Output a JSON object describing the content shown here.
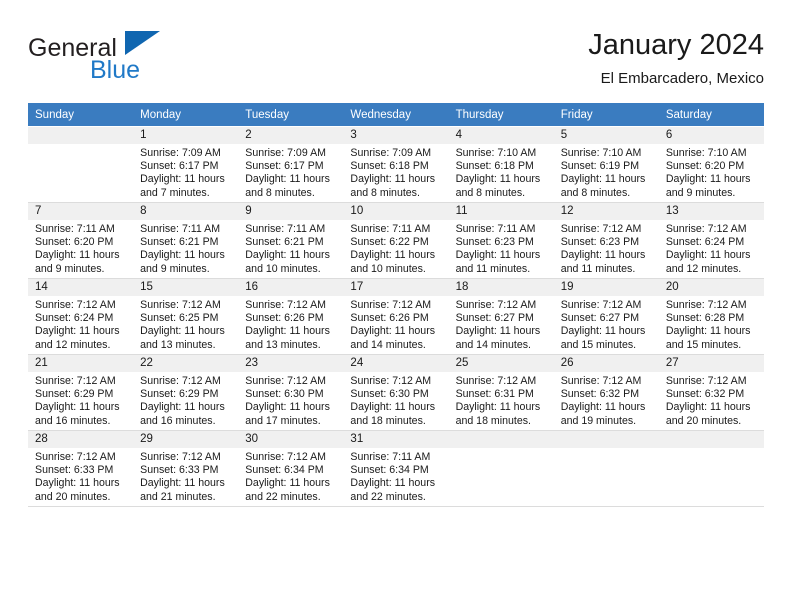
{
  "brand": {
    "name_part1": "General",
    "name_part2": "Blue",
    "triangle_icon": "triangle-logo-icon",
    "accent_color": "#1066b0",
    "text_color": "#2079c7"
  },
  "header": {
    "title": "January 2024",
    "subtitle": "El Embarcadero, Mexico"
  },
  "calendar": {
    "header_bg": "#3a7cc0",
    "header_text_color": "#ffffff",
    "daynum_bg": "#f0f0f0",
    "weekday_headers": [
      "Sunday",
      "Monday",
      "Tuesday",
      "Wednesday",
      "Thursday",
      "Friday",
      "Saturday"
    ],
    "labels": {
      "sunrise": "Sunrise:",
      "sunset": "Sunset:",
      "daylight": "Daylight:"
    },
    "weeks": [
      [
        {
          "day": "",
          "empty": true,
          "sunrise": "",
          "sunset": "",
          "daylight_line1": "",
          "daylight_line2": ""
        },
        {
          "day": "1",
          "sunrise": "Sunrise: 7:09 AM",
          "sunset": "Sunset: 6:17 PM",
          "daylight_line1": "Daylight: 11 hours",
          "daylight_line2": "and 7 minutes."
        },
        {
          "day": "2",
          "sunrise": "Sunrise: 7:09 AM",
          "sunset": "Sunset: 6:17 PM",
          "daylight_line1": "Daylight: 11 hours",
          "daylight_line2": "and 8 minutes."
        },
        {
          "day": "3",
          "sunrise": "Sunrise: 7:09 AM",
          "sunset": "Sunset: 6:18 PM",
          "daylight_line1": "Daylight: 11 hours",
          "daylight_line2": "and 8 minutes."
        },
        {
          "day": "4",
          "sunrise": "Sunrise: 7:10 AM",
          "sunset": "Sunset: 6:18 PM",
          "daylight_line1": "Daylight: 11 hours",
          "daylight_line2": "and 8 minutes."
        },
        {
          "day": "5",
          "sunrise": "Sunrise: 7:10 AM",
          "sunset": "Sunset: 6:19 PM",
          "daylight_line1": "Daylight: 11 hours",
          "daylight_line2": "and 8 minutes."
        },
        {
          "day": "6",
          "sunrise": "Sunrise: 7:10 AM",
          "sunset": "Sunset: 6:20 PM",
          "daylight_line1": "Daylight: 11 hours",
          "daylight_line2": "and 9 minutes."
        }
      ],
      [
        {
          "day": "7",
          "sunrise": "Sunrise: 7:11 AM",
          "sunset": "Sunset: 6:20 PM",
          "daylight_line1": "Daylight: 11 hours",
          "daylight_line2": "and 9 minutes."
        },
        {
          "day": "8",
          "sunrise": "Sunrise: 7:11 AM",
          "sunset": "Sunset: 6:21 PM",
          "daylight_line1": "Daylight: 11 hours",
          "daylight_line2": "and 9 minutes."
        },
        {
          "day": "9",
          "sunrise": "Sunrise: 7:11 AM",
          "sunset": "Sunset: 6:21 PM",
          "daylight_line1": "Daylight: 11 hours",
          "daylight_line2": "and 10 minutes."
        },
        {
          "day": "10",
          "sunrise": "Sunrise: 7:11 AM",
          "sunset": "Sunset: 6:22 PM",
          "daylight_line1": "Daylight: 11 hours",
          "daylight_line2": "and 10 minutes."
        },
        {
          "day": "11",
          "sunrise": "Sunrise: 7:11 AM",
          "sunset": "Sunset: 6:23 PM",
          "daylight_line1": "Daylight: 11 hours",
          "daylight_line2": "and 11 minutes."
        },
        {
          "day": "12",
          "sunrise": "Sunrise: 7:12 AM",
          "sunset": "Sunset: 6:23 PM",
          "daylight_line1": "Daylight: 11 hours",
          "daylight_line2": "and 11 minutes."
        },
        {
          "day": "13",
          "sunrise": "Sunrise: 7:12 AM",
          "sunset": "Sunset: 6:24 PM",
          "daylight_line1": "Daylight: 11 hours",
          "daylight_line2": "and 12 minutes."
        }
      ],
      [
        {
          "day": "14",
          "sunrise": "Sunrise: 7:12 AM",
          "sunset": "Sunset: 6:24 PM",
          "daylight_line1": "Daylight: 11 hours",
          "daylight_line2": "and 12 minutes."
        },
        {
          "day": "15",
          "sunrise": "Sunrise: 7:12 AM",
          "sunset": "Sunset: 6:25 PM",
          "daylight_line1": "Daylight: 11 hours",
          "daylight_line2": "and 13 minutes."
        },
        {
          "day": "16",
          "sunrise": "Sunrise: 7:12 AM",
          "sunset": "Sunset: 6:26 PM",
          "daylight_line1": "Daylight: 11 hours",
          "daylight_line2": "and 13 minutes."
        },
        {
          "day": "17",
          "sunrise": "Sunrise: 7:12 AM",
          "sunset": "Sunset: 6:26 PM",
          "daylight_line1": "Daylight: 11 hours",
          "daylight_line2": "and 14 minutes."
        },
        {
          "day": "18",
          "sunrise": "Sunrise: 7:12 AM",
          "sunset": "Sunset: 6:27 PM",
          "daylight_line1": "Daylight: 11 hours",
          "daylight_line2": "and 14 minutes."
        },
        {
          "day": "19",
          "sunrise": "Sunrise: 7:12 AM",
          "sunset": "Sunset: 6:27 PM",
          "daylight_line1": "Daylight: 11 hours",
          "daylight_line2": "and 15 minutes."
        },
        {
          "day": "20",
          "sunrise": "Sunrise: 7:12 AM",
          "sunset": "Sunset: 6:28 PM",
          "daylight_line1": "Daylight: 11 hours",
          "daylight_line2": "and 15 minutes."
        }
      ],
      [
        {
          "day": "21",
          "sunrise": "Sunrise: 7:12 AM",
          "sunset": "Sunset: 6:29 PM",
          "daylight_line1": "Daylight: 11 hours",
          "daylight_line2": "and 16 minutes."
        },
        {
          "day": "22",
          "sunrise": "Sunrise: 7:12 AM",
          "sunset": "Sunset: 6:29 PM",
          "daylight_line1": "Daylight: 11 hours",
          "daylight_line2": "and 16 minutes."
        },
        {
          "day": "23",
          "sunrise": "Sunrise: 7:12 AM",
          "sunset": "Sunset: 6:30 PM",
          "daylight_line1": "Daylight: 11 hours",
          "daylight_line2": "and 17 minutes."
        },
        {
          "day": "24",
          "sunrise": "Sunrise: 7:12 AM",
          "sunset": "Sunset: 6:30 PM",
          "daylight_line1": "Daylight: 11 hours",
          "daylight_line2": "and 18 minutes."
        },
        {
          "day": "25",
          "sunrise": "Sunrise: 7:12 AM",
          "sunset": "Sunset: 6:31 PM",
          "daylight_line1": "Daylight: 11 hours",
          "daylight_line2": "and 18 minutes."
        },
        {
          "day": "26",
          "sunrise": "Sunrise: 7:12 AM",
          "sunset": "Sunset: 6:32 PM",
          "daylight_line1": "Daylight: 11 hours",
          "daylight_line2": "and 19 minutes."
        },
        {
          "day": "27",
          "sunrise": "Sunrise: 7:12 AM",
          "sunset": "Sunset: 6:32 PM",
          "daylight_line1": "Daylight: 11 hours",
          "daylight_line2": "and 20 minutes."
        }
      ],
      [
        {
          "day": "28",
          "sunrise": "Sunrise: 7:12 AM",
          "sunset": "Sunset: 6:33 PM",
          "daylight_line1": "Daylight: 11 hours",
          "daylight_line2": "and 20 minutes."
        },
        {
          "day": "29",
          "sunrise": "Sunrise: 7:12 AM",
          "sunset": "Sunset: 6:33 PM",
          "daylight_line1": "Daylight: 11 hours",
          "daylight_line2": "and 21 minutes."
        },
        {
          "day": "30",
          "sunrise": "Sunrise: 7:12 AM",
          "sunset": "Sunset: 6:34 PM",
          "daylight_line1": "Daylight: 11 hours",
          "daylight_line2": "and 22 minutes."
        },
        {
          "day": "31",
          "sunrise": "Sunrise: 7:11 AM",
          "sunset": "Sunset: 6:34 PM",
          "daylight_line1": "Daylight: 11 hours",
          "daylight_line2": "and 22 minutes."
        },
        {
          "day": "",
          "empty": true,
          "sunrise": "",
          "sunset": "",
          "daylight_line1": "",
          "daylight_line2": ""
        },
        {
          "day": "",
          "empty": true,
          "sunrise": "",
          "sunset": "",
          "daylight_line1": "",
          "daylight_line2": ""
        },
        {
          "day": "",
          "empty": true,
          "sunrise": "",
          "sunset": "",
          "daylight_line1": "",
          "daylight_line2": ""
        }
      ]
    ]
  }
}
